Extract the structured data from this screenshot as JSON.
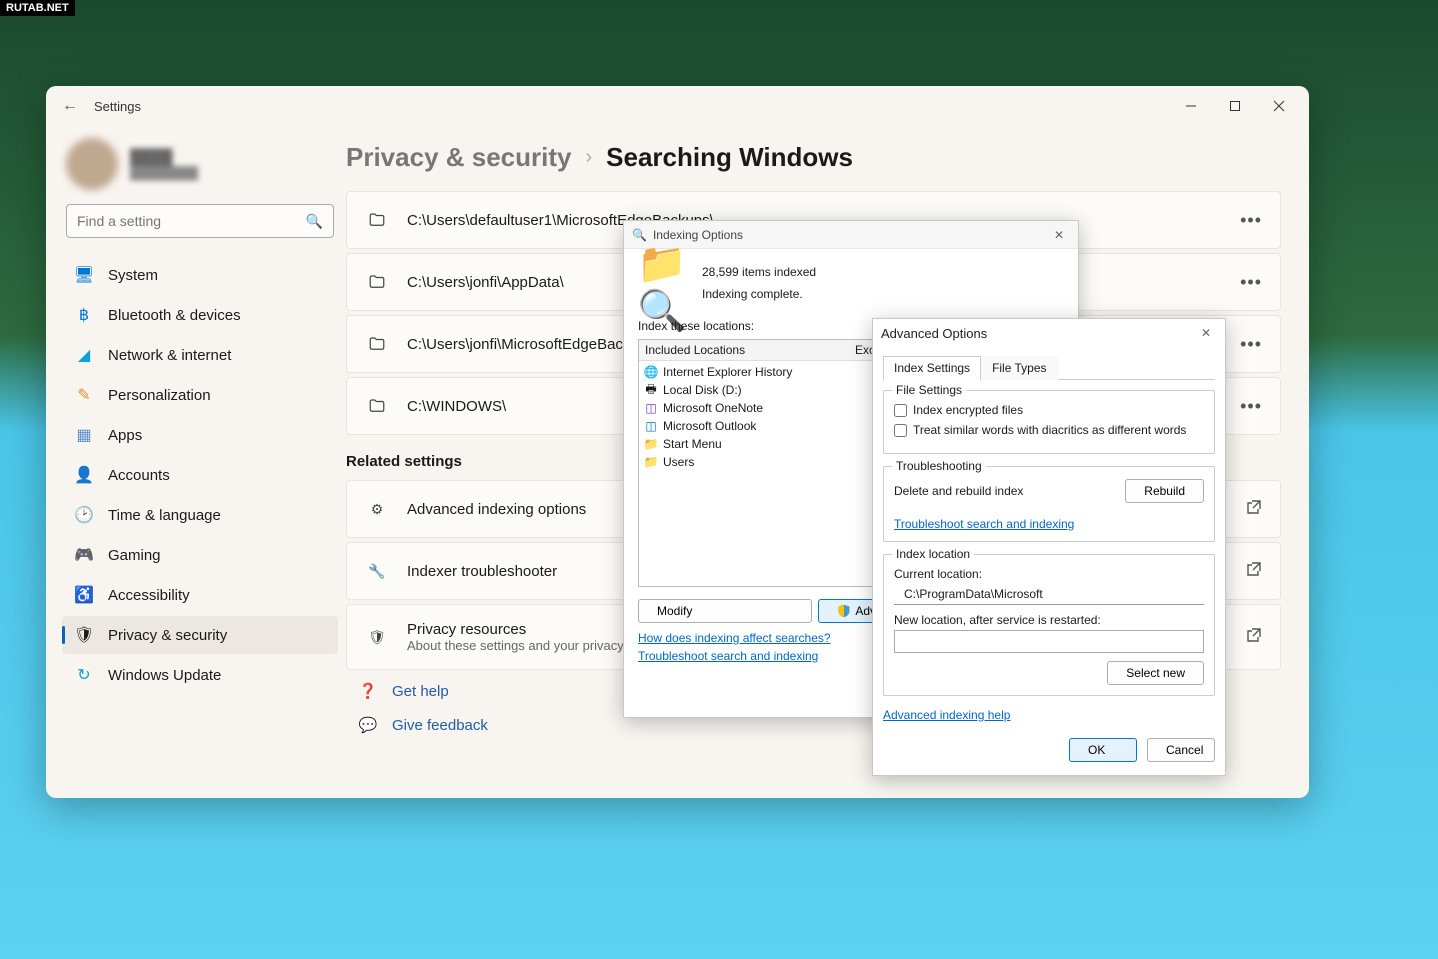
{
  "watermark": "RUTAB.NET",
  "settings": {
    "app_title": "Settings",
    "search_placeholder": "Find a setting",
    "nav": [
      {
        "label": "System"
      },
      {
        "label": "Bluetooth & devices"
      },
      {
        "label": "Network & internet"
      },
      {
        "label": "Personalization"
      },
      {
        "label": "Apps"
      },
      {
        "label": "Accounts"
      },
      {
        "label": "Time & language"
      },
      {
        "label": "Gaming"
      },
      {
        "label": "Accessibility"
      },
      {
        "label": "Privacy & security"
      },
      {
        "label": "Windows Update"
      }
    ],
    "breadcrumb": {
      "parent": "Privacy & security",
      "current": "Searching Windows"
    },
    "paths": [
      "C:\\Users\\defaultuser1\\MicrosoftEdgeBackups\\",
      "C:\\Users\\jonfi\\AppData\\",
      "C:\\Users\\jonfi\\MicrosoftEdgeBackups\\",
      "C:\\WINDOWS\\"
    ],
    "related_heading": "Related settings",
    "related": [
      {
        "title": "Advanced indexing options",
        "sub": "",
        "action": "open"
      },
      {
        "title": "Indexer troubleshooter",
        "sub": "",
        "action": "open"
      },
      {
        "title": "Privacy resources",
        "sub": "About these settings and your privacy",
        "action": "open"
      }
    ],
    "help_links": {
      "get_help": "Get help",
      "feedback": "Give feedback"
    }
  },
  "indexing": {
    "title": "Indexing Options",
    "items_indexed": "28,599 items indexed",
    "status": "Indexing complete.",
    "locations_label": "Index these locations:",
    "columns": {
      "included": "Included Locations",
      "exclude": "Exclude"
    },
    "rows": [
      "Internet Explorer History",
      "Local Disk (D:)",
      "Microsoft OneNote",
      "Microsoft Outlook",
      "Start Menu",
      "Users"
    ],
    "buttons": {
      "modify": "Modify",
      "advanced": "Advanced"
    },
    "links": {
      "affect": "How does indexing affect searches?",
      "troubleshoot": "Troubleshoot search and indexing"
    }
  },
  "advanced": {
    "title": "Advanced Options",
    "tabs": {
      "settings": "Index Settings",
      "types": "File Types"
    },
    "file_settings": {
      "legend": "File Settings",
      "encrypted": "Index encrypted files",
      "diacritics": "Treat similar words with diacritics as different words"
    },
    "troubleshooting": {
      "legend": "Troubleshooting",
      "delete": "Delete and rebuild index",
      "rebuild": "Rebuild",
      "link": "Troubleshoot search and indexing"
    },
    "index_location": {
      "legend": "Index location",
      "current_label": "Current location:",
      "current_value": "C:\\ProgramData\\Microsoft",
      "new_label": "New location, after service is restarted:",
      "select_new": "Select new"
    },
    "help_link": "Advanced indexing help",
    "footer": {
      "ok": "OK",
      "cancel": "Cancel"
    }
  }
}
